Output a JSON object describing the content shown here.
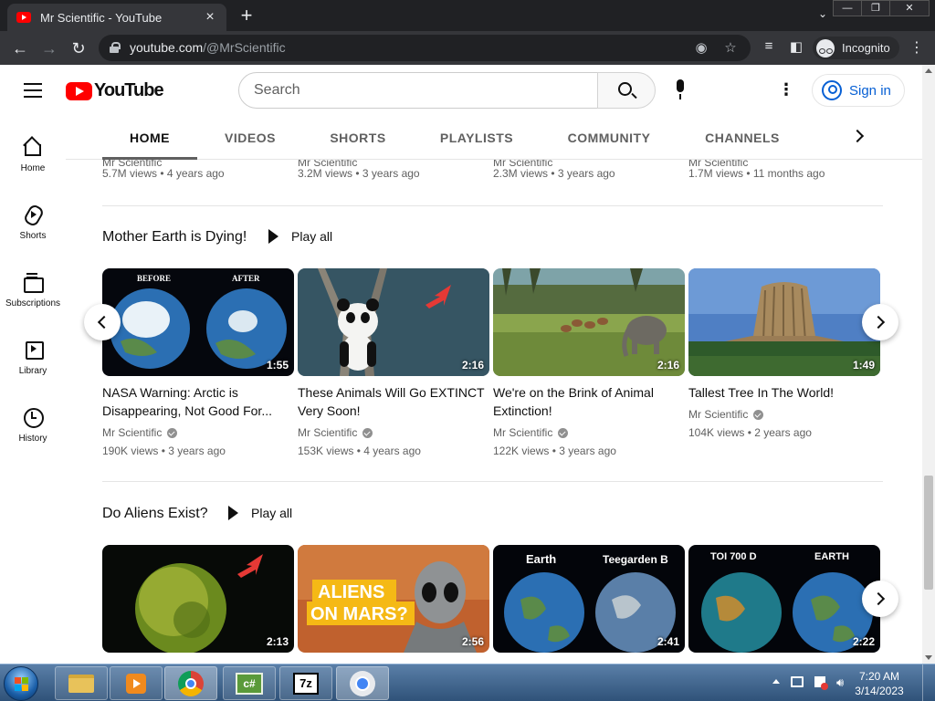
{
  "browser": {
    "tab_title": "Mr Scientific - YouTube",
    "tab_close": "×",
    "new_tab": "+",
    "tab_menu": "⌄",
    "window_controls": {
      "minimize": "—",
      "maximize": "❐",
      "close": "✕"
    },
    "back": "←",
    "forward": "→",
    "reload": "↻",
    "url_host": "youtube.com",
    "url_path": "/@MrScientific",
    "incognito_label": "Incognito",
    "menu": "⋮"
  },
  "masthead": {
    "logo_text": "YouTube",
    "search_placeholder": "Search",
    "more": "⋮",
    "signin_label": "Sign in"
  },
  "guide": {
    "items": [
      {
        "label": "Home",
        "icon": "home-icon"
      },
      {
        "label": "Shorts",
        "icon": "shorts-icon"
      },
      {
        "label": "Subscriptions",
        "icon": "subscriptions-icon"
      },
      {
        "label": "Library",
        "icon": "library-icon"
      },
      {
        "label": "History",
        "icon": "history-icon"
      }
    ]
  },
  "channel_tabs": [
    "HOME",
    "VIDEOS",
    "SHORTS",
    "PLAYLISTS",
    "COMMUNITY",
    "CHANNELS"
  ],
  "top_row": {
    "channel": "Mr Scientific",
    "items": [
      "5.7M views • 4 years ago",
      "3.2M views • 3 years ago",
      "2.3M views • 3 years ago",
      "1.7M views • 11 months ago"
    ]
  },
  "shelves": [
    {
      "title": "Mother Earth is Dying!",
      "play_all": "Play all",
      "videos": [
        {
          "title": "NASA Warning: Arctic is Disappearing, Not Good For...",
          "channel": "Mr Scientific",
          "views": "190K views • 3 years ago",
          "duration": "1:55",
          "thumb_before": "BEFORE",
          "thumb_after": "AFTER"
        },
        {
          "title": "These Animals Will Go EXTINCT Very Soon!",
          "channel": "Mr Scientific",
          "views": "153K views • 4 years ago",
          "duration": "2:16"
        },
        {
          "title": "We're on the Brink of Animal Extinction!",
          "channel": "Mr Scientific",
          "views": "122K views • 3 years ago",
          "duration": "2:16"
        },
        {
          "title": "Tallest Tree In The World!",
          "channel": "Mr Scientific",
          "views": "104K views • 2 years ago",
          "duration": "1:49"
        }
      ]
    },
    {
      "title": "Do Aliens Exist?",
      "play_all": "Play all",
      "videos": [
        {
          "duration": "2:13"
        },
        {
          "duration": "2:56",
          "thumb_line1": "ALIENS",
          "thumb_line2": "ON MARS?"
        },
        {
          "duration": "2:41",
          "thumb_left": "Earth",
          "thumb_right": "Teegarden B"
        },
        {
          "duration": "2:22",
          "thumb_left": "TOI 700 D",
          "thumb_right": "EARTH"
        }
      ]
    }
  ],
  "taskbar": {
    "time": "7:20 AM",
    "date": "3/14/2023",
    "apps": [
      "file-explorer-icon",
      "media-player-icon",
      "chrome-icon",
      "csharp-icon",
      "7zip-icon",
      "chrome-incognito-icon"
    ],
    "csharp_text": "c#",
    "sevenzip_text": "7z"
  },
  "colors": {
    "brand_red": "#ff0000",
    "link_blue": "#065fd4",
    "text_primary": "#0f0f0f",
    "text_secondary": "#606060",
    "chrome_dark": "#35363a"
  }
}
